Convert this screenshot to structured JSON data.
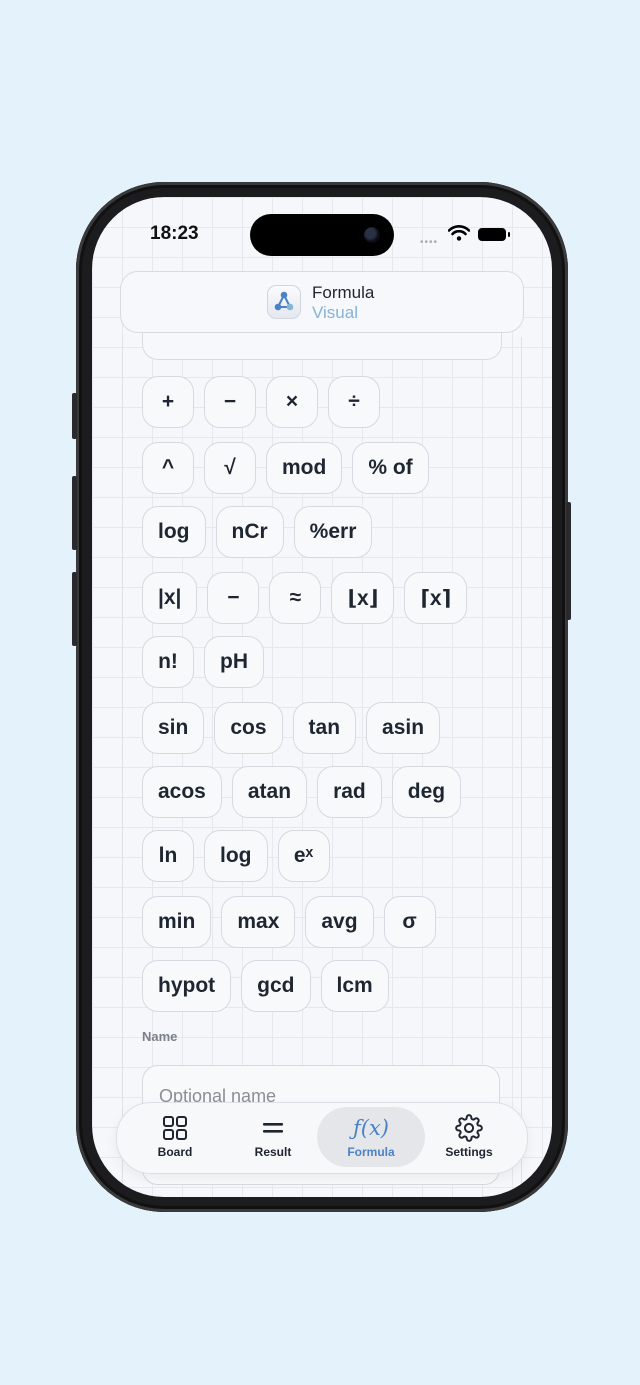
{
  "status": {
    "time": "18:23",
    "signal": "••••"
  },
  "header": {
    "brand_line1": "Formula",
    "brand_line2": "Visual"
  },
  "keypad": {
    "rows": [
      [
        "+",
        "−",
        "×",
        "÷"
      ],
      [
        "^",
        "√",
        "mod",
        "% of"
      ],
      [
        "log",
        "nCr",
        "%err"
      ],
      [
        "|x|",
        "−",
        "≈",
        "⌊x⌋",
        "⌈x⌉"
      ],
      [
        "n!",
        "pH"
      ],
      [
        "sin",
        "cos",
        "tan",
        "asin"
      ],
      [
        "acos",
        "atan",
        "rad",
        "deg"
      ],
      [
        "ln",
        "log",
        "eˣ"
      ],
      [
        "min",
        "max",
        "avg",
        "σ"
      ],
      [
        "hypot",
        "gcd",
        "lcm"
      ]
    ]
  },
  "name_field": {
    "label": "Name",
    "placeholder": "Optional name"
  },
  "tabs": [
    {
      "label": "Board",
      "icon": "grid-icon",
      "active": false
    },
    {
      "label": "Result",
      "icon": "equals-icon",
      "active": false
    },
    {
      "label": "Formula",
      "icon": "fx-icon",
      "active": true
    },
    {
      "label": "Settings",
      "icon": "gear-icon",
      "active": false
    }
  ],
  "colors": {
    "accent": "#4b82c6",
    "brand_secondary": "#86b4d6",
    "background": "#e4f3fb"
  }
}
